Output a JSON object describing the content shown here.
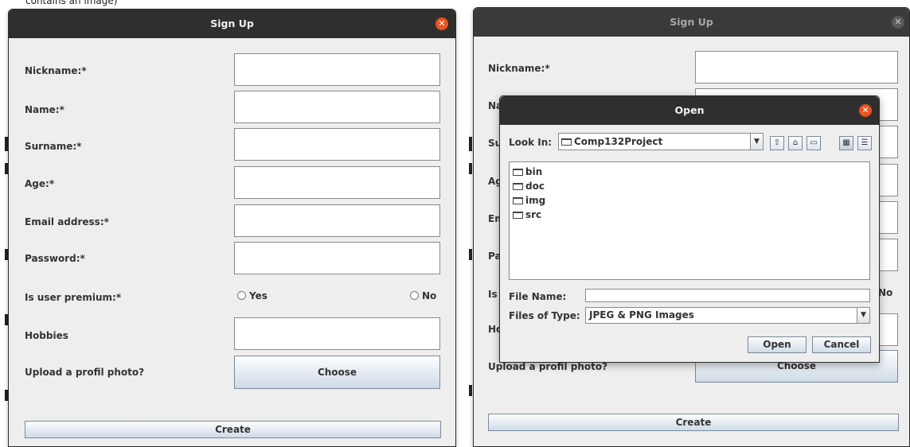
{
  "background": {
    "top_text": "contains an image)"
  },
  "signup_left": {
    "title": "Sign Up",
    "fields": [
      {
        "label": "Nickname:*"
      },
      {
        "label": "Name:*"
      },
      {
        "label": "Surname:*"
      },
      {
        "label": "Age:*"
      },
      {
        "label": "Email address:*"
      },
      {
        "label": "Password:*"
      }
    ],
    "premium_label": "Is user premium:*",
    "premium_yes": "Yes",
    "premium_no": "No",
    "hobbies_label": "Hobbies",
    "photo_label": "Upload a profil photo?",
    "choose_label": "Choose",
    "create_label": "Create"
  },
  "signup_right": {
    "title": "Sign Up",
    "visible_labels": [
      "Nickname:*",
      "Na",
      "Su",
      "Ag",
      "Em",
      "Pa",
      "Is",
      "Ho"
    ],
    "premium_no": "No",
    "photo_label": "Upload a profil photo?",
    "choose_label": "Choose",
    "create_label": "Create"
  },
  "open_dialog": {
    "title": "Open",
    "look_in_label": "Look In:",
    "look_in_value": "Comp132Project",
    "files": [
      "bin",
      "doc",
      "img",
      "src"
    ],
    "file_name_label": "File Name:",
    "file_name_value": "",
    "files_of_type_label": "Files of Type:",
    "files_of_type_value": "JPEG & PNG Images",
    "open_label": "Open",
    "cancel_label": "Cancel"
  },
  "colors": {
    "close_active": "#e95420",
    "titlebar": "#2f2f2f",
    "button_top": "#fdfdfe",
    "button_bottom": "#cfdbe8"
  }
}
